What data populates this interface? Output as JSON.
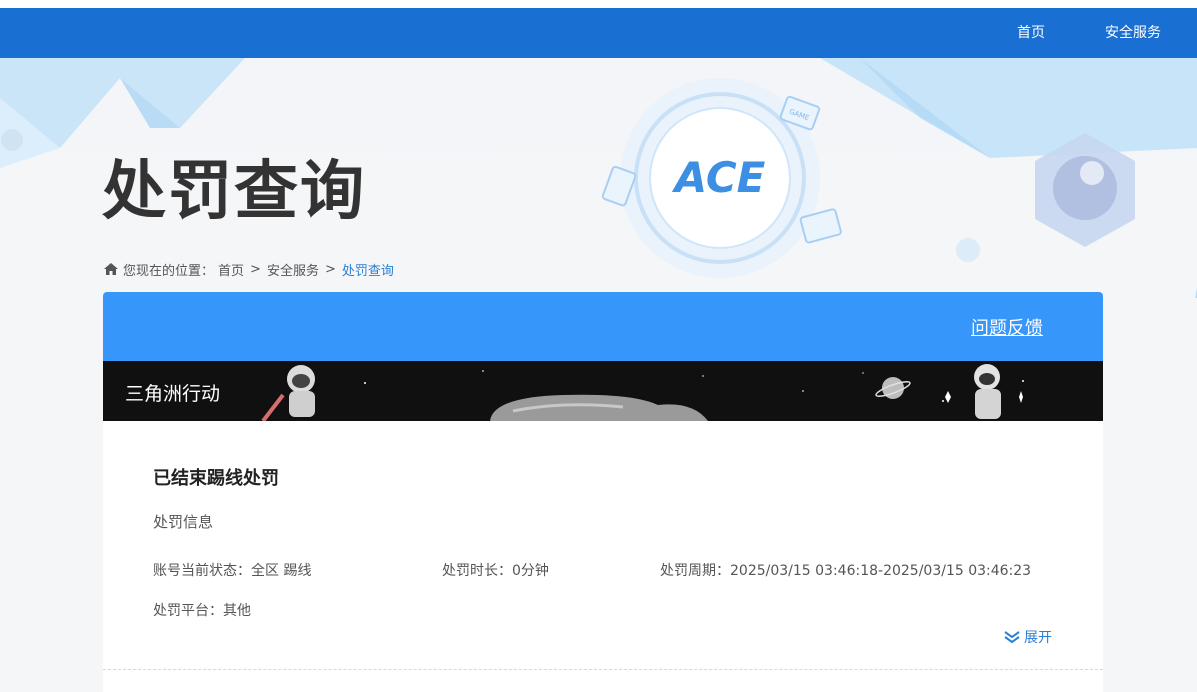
{
  "nav": {
    "items": [
      {
        "label": "首页"
      },
      {
        "label": "安全服务"
      }
    ]
  },
  "hero": {
    "title": "处罚查询",
    "logo_text": "ACE",
    "badge_text": "GAME"
  },
  "breadcrumb": {
    "prefix": "您现在的位置：",
    "items": [
      "首页",
      "安全服务"
    ],
    "current": "处罚查询",
    "separator": ">"
  },
  "card": {
    "feedback_label": "问题反馈",
    "game_name": "三角洲行动",
    "section_title": "已结束踢线处罚",
    "info_heading": "处罚信息",
    "fields": {
      "status_label": "账号当前状态：",
      "status_value": "全区 踢线",
      "duration_label": "处罚时长：",
      "duration_value": "0分钟",
      "period_label": "处罚周期：",
      "period_value": "2025/03/15 03:46:18-2025/03/15 03:46:23",
      "platform_label": "处罚平台：",
      "platform_value": "其他"
    },
    "expand_label": "展开"
  },
  "colors": {
    "nav_bg": "#1a6fd3",
    "card_head_bg": "#3796fa",
    "link_blue": "#2a7fd6",
    "banner_bg": "#101010"
  }
}
